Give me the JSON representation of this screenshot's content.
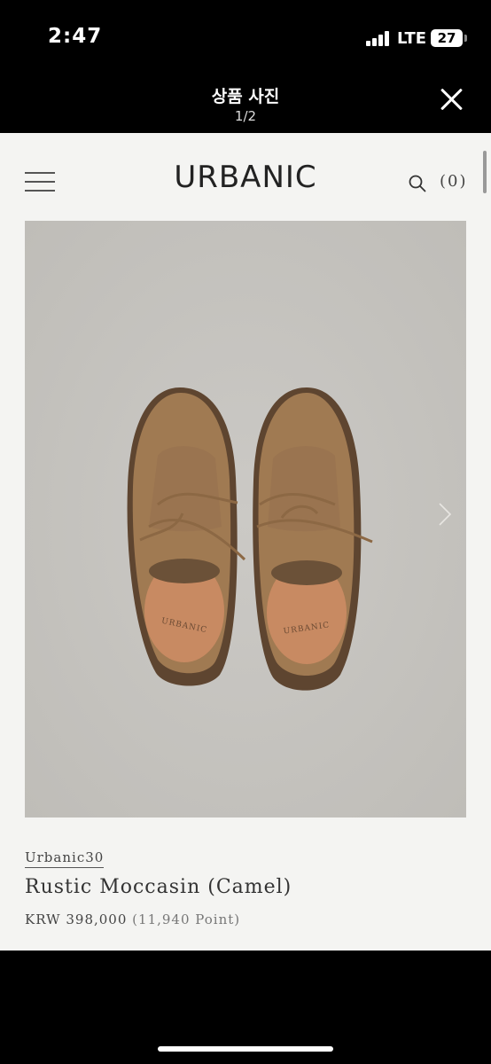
{
  "status_bar": {
    "time": "2:47",
    "network": "LTE",
    "battery": "27"
  },
  "modal": {
    "title": "상품 사진",
    "counter": "1/2"
  },
  "site": {
    "brand": "URBANIC",
    "cart_count": "(0)"
  },
  "product": {
    "brand_label": "Urbanic30",
    "name": "Rustic Moccasin (Camel)",
    "price": "KRW 398,000",
    "points": "(11,940 Point)",
    "insole_brand": "URBANIC"
  },
  "colors": {
    "background": "#f4f4f2",
    "photo_background": "#c7c5c1",
    "suede": "#a07a52"
  }
}
